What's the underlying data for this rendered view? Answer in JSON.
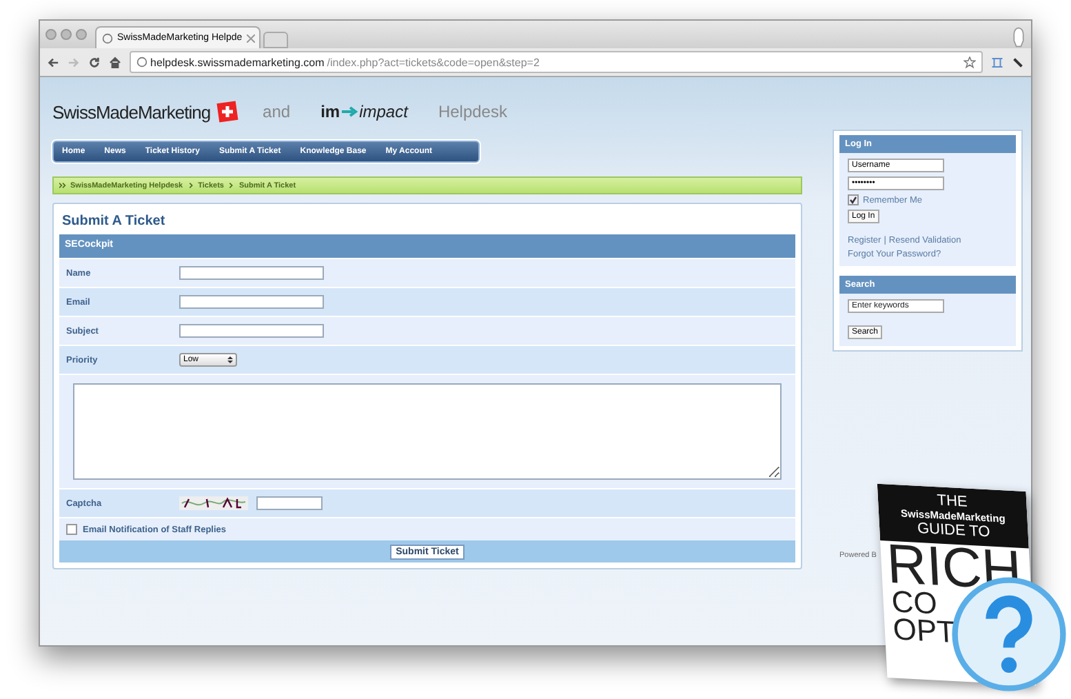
{
  "browser": {
    "tab_title": "SwissMadeMarketing Helpde",
    "url_host": "helpdesk.swissmademarketing.com",
    "url_path": "/index.php?act=tickets&code=open&step=2"
  },
  "header": {
    "brand": "SwissMadeMarketing",
    "and": "and",
    "partner_a": "im",
    "partner_b": "impact",
    "product": "Helpdesk"
  },
  "nav": [
    "Home",
    "News",
    "Ticket History",
    "Submit A Ticket",
    "Knowledge Base",
    "My Account"
  ],
  "breadcrumb": [
    "SwissMadeMarketing Helpdesk",
    "Tickets",
    "Submit A Ticket"
  ],
  "form": {
    "title": "Submit A Ticket",
    "section": "SECockpit",
    "fields": [
      {
        "kind": "text",
        "label": "Name"
      },
      {
        "kind": "text",
        "label": "Email"
      },
      {
        "kind": "text",
        "label": "Subject"
      },
      {
        "kind": "select",
        "label": "Priority",
        "value": "Low"
      },
      {
        "kind": "textarea"
      },
      {
        "kind": "captcha",
        "label": "Captcha"
      },
      {
        "kind": "checkbox",
        "label": "Email Notification of Staff Replies",
        "checked": false
      }
    ],
    "submit": "Submit Ticket"
  },
  "login": {
    "title": "Log In",
    "username": "Username",
    "password": "••••••••",
    "remember": {
      "label": "Remember Me",
      "checked": true
    },
    "button": "Log In",
    "links": [
      "Register",
      "Resend Validation"
    ],
    "link_separator": "|",
    "forgot": "Forgot Your Password?"
  },
  "search": {
    "title": "Search",
    "placeholder": "Enter keywords",
    "button": "Search"
  },
  "footer": "Powered B",
  "book": {
    "line1": "THE",
    "brand": "SwissMadeMarketing",
    "line2": "GUIDE TO",
    "big1": "RICH",
    "big2": "CO",
    "big3": "OPT"
  }
}
